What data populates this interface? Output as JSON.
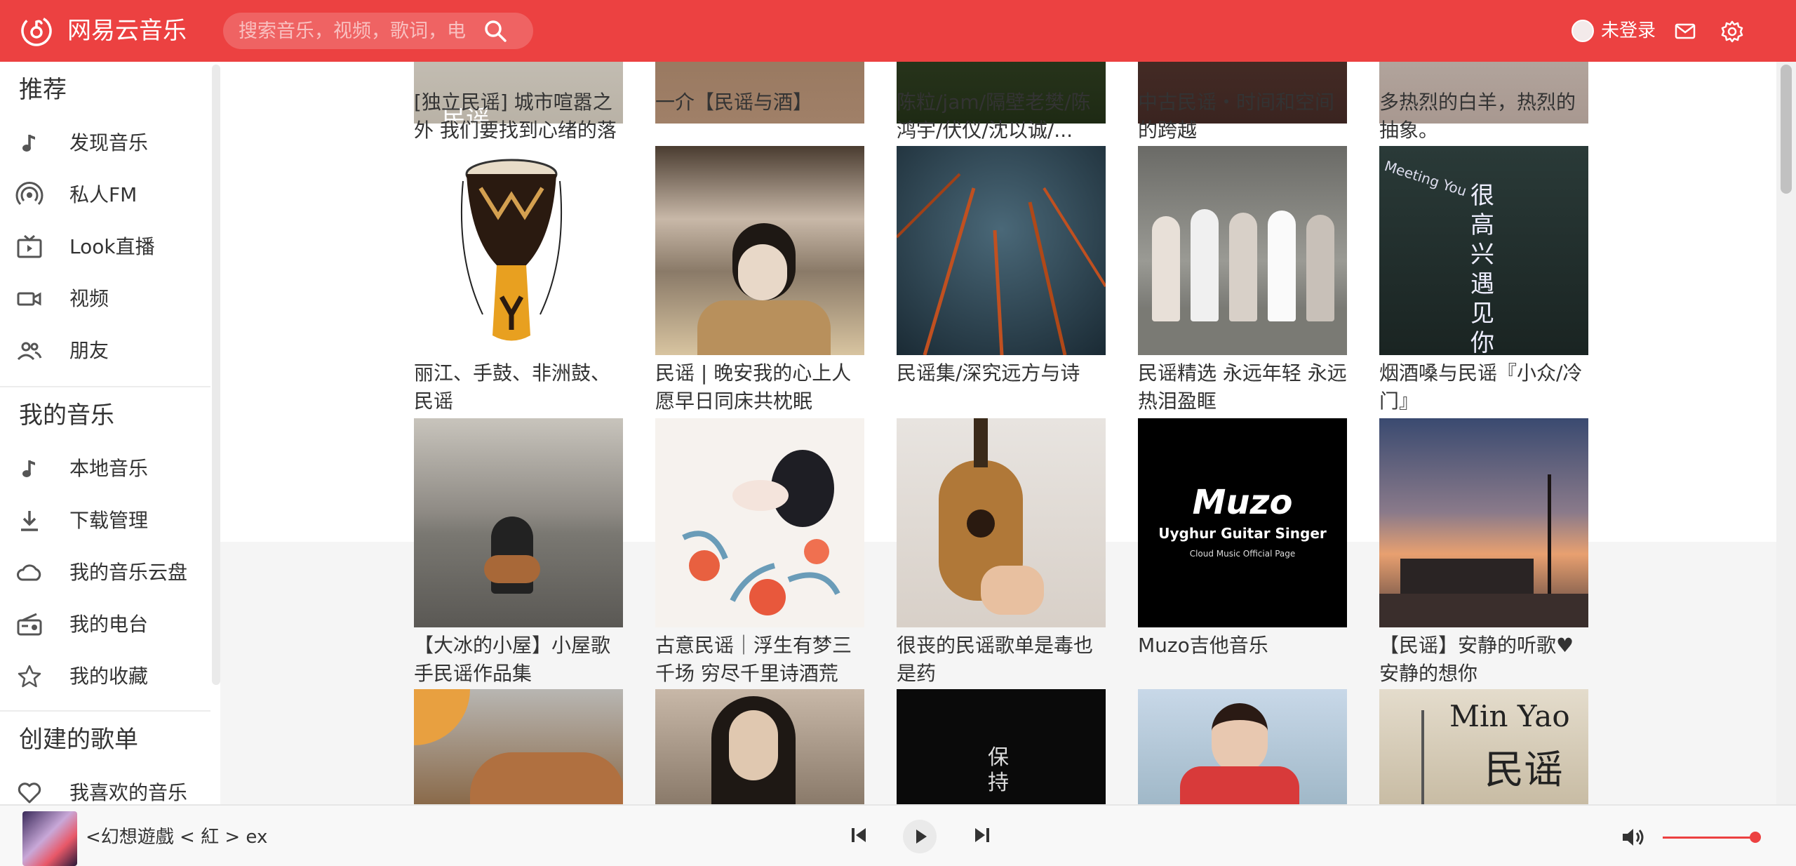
{
  "header": {
    "brand": "网易云音乐",
    "search_placeholder": "搜索音乐，视频，歌词，电",
    "user_label": "未登录",
    "bg_color": "#ec4141"
  },
  "sidebar": {
    "sections": [
      {
        "heading": "推荐",
        "items": [
          {
            "label": "发现音乐",
            "icon": "music-note-icon"
          },
          {
            "label": "私人FM",
            "icon": "radio-signal-icon"
          },
          {
            "label": "Look直播",
            "icon": "tv-icon"
          },
          {
            "label": "视频",
            "icon": "video-camera-icon"
          },
          {
            "label": "朋友",
            "icon": "friends-icon"
          }
        ]
      },
      {
        "heading": "我的音乐",
        "items": [
          {
            "label": "本地音乐",
            "icon": "music-note-icon"
          },
          {
            "label": "下载管理",
            "icon": "download-icon"
          },
          {
            "label": "我的音乐云盘",
            "icon": "cloud-icon"
          },
          {
            "label": "我的电台",
            "icon": "radio-icon"
          },
          {
            "label": "我的收藏",
            "icon": "star-icon"
          }
        ]
      },
      {
        "heading": "创建的歌单",
        "items": [
          {
            "label": "我喜欢的音乐",
            "icon": "heart-icon"
          }
        ]
      }
    ]
  },
  "playlists": {
    "row0_titles": [
      "[独立民谣] 城市喧嚣之外 我们要找到心绪的落",
      "一介【民谣与酒】",
      "陈粒/jam/隔壁老樊/陈鸿宇/伏仪/沈以诚/...",
      "中古民谣・时间和空间的跨越",
      "多热烈的白羊，热烈的抽象。"
    ],
    "row1_titles": [
      "丽江、手鼓、非洲鼓、民谣",
      "民谣 | 晚安我的心上人 愿早日同床共枕眠",
      "民谣集/深究远方与诗",
      "民谣精选 永远年轻 永远热泪盈眶",
      "烟酒嗓与民谣『小众/冷门』"
    ],
    "row2_titles": [
      "【大冰的小屋】小屋歌手民谣作品集",
      "古意民谣｜浮生有梦三千场 穷尽千里诗酒荒",
      "很丧的民谣歌单是毒也是药",
      "Muzo吉他音乐",
      "【民谣】安静的听歌♥安静的想你"
    ],
    "cover_texts": {
      "muzo_title": "Muzo",
      "muzo_sub": "Uyghur Guitar Singer",
      "muzo_sub2": "Cloud Music Official Page",
      "meeting_you": "Meeting You",
      "very_glad": "很高兴遇见你",
      "min_yao_latin": "Min Yao",
      "min_yao_cn": "民谣",
      "baochi": "保持",
      "row0_first_text": "民谣"
    }
  },
  "player": {
    "song_title": "<幻想遊戲 < 紅 > ex",
    "accent": "#ec4141"
  }
}
